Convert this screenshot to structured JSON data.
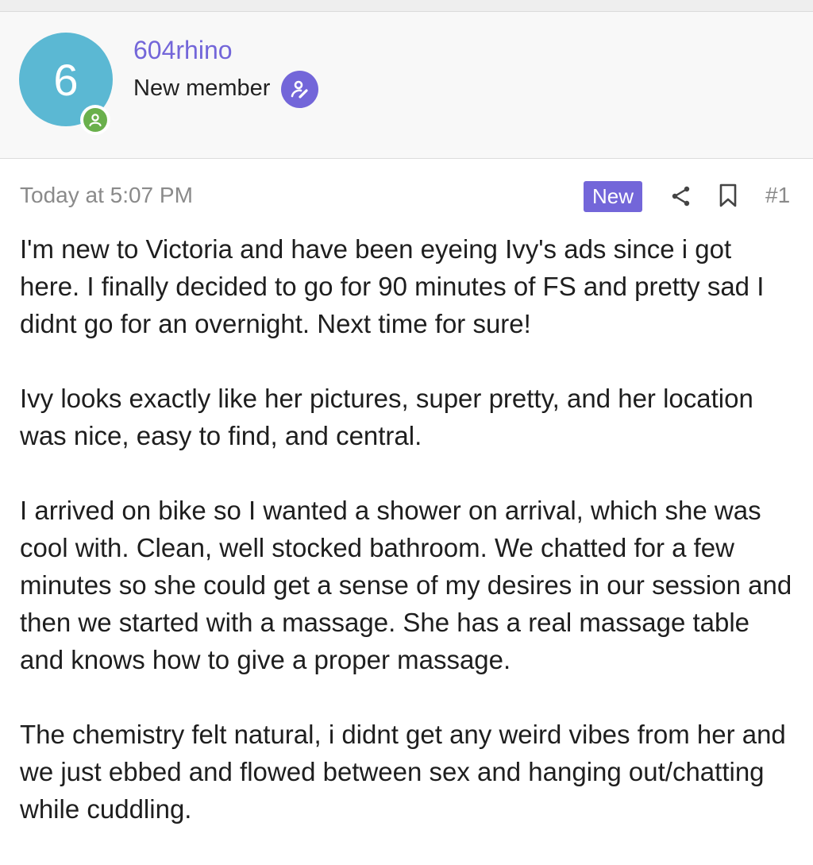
{
  "colors": {
    "accent": "#7366d9",
    "avatar_bg": "#5bb8d3",
    "online": "#6ab04c",
    "muted_text": "#8a8a8a",
    "header_bg": "#f8f8f8"
  },
  "author": {
    "avatar_letter": "6",
    "username": "604rhino",
    "title": "New member",
    "status_icon": "user-online-icon",
    "badge_icon": "user-edit-icon"
  },
  "post": {
    "date": "Today at 5:07 PM",
    "new_label": "New",
    "number": "#1",
    "share_icon": "share-icon",
    "bookmark_icon": "bookmark-icon",
    "paragraphs": [
      "I'm new to Victoria and have been eyeing Ivy's ads since i got here. I finally decided to go for 90 minutes of FS and pretty sad I didnt go for an overnight. Next time for sure!",
      "Ivy looks exactly like her pictures, super pretty, and her location was nice, easy to find, and central.",
      "I arrived on bike so I wanted a shower on arrival, which she was cool with. Clean, well stocked bathroom. We chatted for a few minutes so she could get a sense of my desires in our session and then we started with a massage. She has a real massage table and knows how to give a proper massage.",
      "The chemistry felt natural, i didnt get any weird vibes from her and we just ebbed and flowed between sex and hanging out/chatting while cuddling."
    ]
  }
}
